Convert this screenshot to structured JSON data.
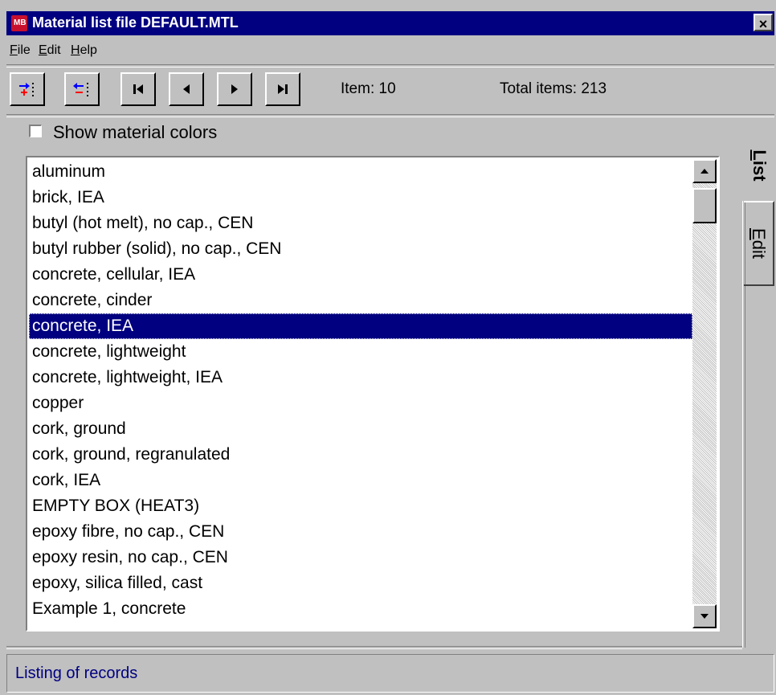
{
  "window": {
    "title": "Material list file DEFAULT.MTL",
    "close_label": "×"
  },
  "menu": {
    "items": [
      {
        "prefix": "",
        "mnemonic": "F",
        "rest": "ile"
      },
      {
        "prefix": "",
        "mnemonic": "E",
        "rest": "dit"
      },
      {
        "prefix": "",
        "mnemonic": "H",
        "rest": "elp"
      }
    ]
  },
  "toolbar": {
    "buttons": [
      {
        "name": "insert-record-icon"
      },
      {
        "name": "delete-record-icon"
      },
      {
        "name": "first-record-icon"
      },
      {
        "name": "previous-record-icon"
      },
      {
        "name": "next-record-icon"
      },
      {
        "name": "last-record-icon"
      }
    ],
    "item_label": "Item: 10",
    "total_label": "Total items: 213"
  },
  "show_colors": {
    "label": "Show material colors",
    "checked": false
  },
  "materials": {
    "selected_index": 6,
    "items": [
      "aluminum",
      "brick, IEA",
      "butyl (hot melt), no cap., CEN",
      "butyl rubber (solid), no cap., CEN",
      "concrete, cellular, IEA",
      "concrete, cinder",
      "concrete, IEA",
      "concrete, lightweight",
      "concrete, lightweight, IEA",
      "copper",
      "cork, ground",
      "cork, ground, regranulated",
      "cork, IEA",
      "EMPTY BOX (HEAT3)",
      "epoxy fibre, no cap., CEN",
      "epoxy resin, no cap., CEN",
      "epoxy, silica filled, cast",
      "Example 1, concrete"
    ]
  },
  "tabs": {
    "list": {
      "mnemonic": "L",
      "rest": "ist"
    },
    "edit": {
      "mnemonic": "E",
      "rest": "dit"
    }
  },
  "status": {
    "text": "Listing of records"
  },
  "colors": {
    "title_bar": "#000080",
    "selection": "#000080",
    "status_text": "#000080",
    "icon_red": "#ff0000",
    "icon_blue": "#0000ff"
  }
}
